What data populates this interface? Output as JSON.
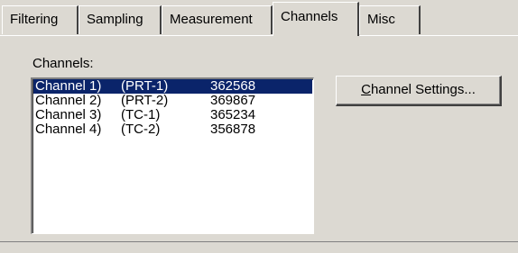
{
  "tabs": [
    {
      "label": "Filtering",
      "selected": false
    },
    {
      "label": "Sampling",
      "selected": false
    },
    {
      "label": "Measurement",
      "selected": false
    },
    {
      "label": "Channels",
      "selected": true
    },
    {
      "label": "Misc",
      "selected": false
    }
  ],
  "channels_panel": {
    "label": "Channels:",
    "rows": [
      {
        "name": "Channel 1)",
        "type": "(PRT-1)",
        "serial": "362568",
        "selected": true
      },
      {
        "name": "Channel 2)",
        "type": "(PRT-2)",
        "serial": "369867",
        "selected": false
      },
      {
        "name": "Channel 3)",
        "type": "(TC-1)",
        "serial": "365234",
        "selected": false
      },
      {
        "name": "Channel 4)",
        "type": "(TC-2)",
        "serial": "356878",
        "selected": false
      }
    ],
    "settings_button": {
      "accel": "C",
      "rest": "hannel Settings..."
    }
  },
  "colors": {
    "face": "#dcd9d2",
    "selection": "#0a246a"
  }
}
